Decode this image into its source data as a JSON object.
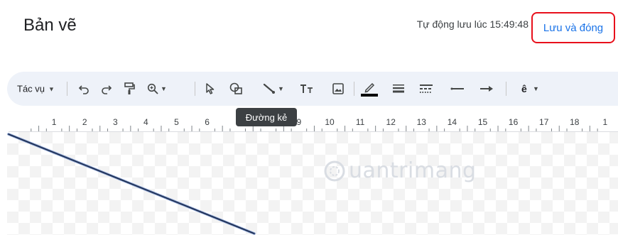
{
  "header": {
    "title": "Bản vẽ",
    "autosave_text": "Tự động lưu lúc 15:49:48",
    "save_close_label": "Lưu và đóng"
  },
  "toolbar": {
    "actions_label": "Tác vụ",
    "tooltip": "Đường kẻ",
    "icons": [
      "undo-icon",
      "redo-icon",
      "paint-format-icon",
      "zoom-icon",
      "select-icon",
      "shape-icon",
      "line-icon",
      "text-box-icon",
      "image-icon",
      "line-color-icon",
      "line-weight-icon",
      "line-dash-icon",
      "line-start-icon",
      "line-end-icon",
      "font-icon"
    ]
  },
  "ruler": {
    "labels": [
      "1",
      "2",
      "3",
      "4",
      "5",
      "6",
      "7",
      "8",
      "9",
      "10",
      "11",
      "12",
      "13",
      "14",
      "15",
      "16",
      "17",
      "18",
      "1"
    ]
  },
  "canvas": {
    "watermark": "uantrimang"
  },
  "colors": {
    "accent": "#1a73e8",
    "highlight": "#e8101b",
    "toolbar_bg": "#eef2f9",
    "line": "#1b2a4a"
  }
}
